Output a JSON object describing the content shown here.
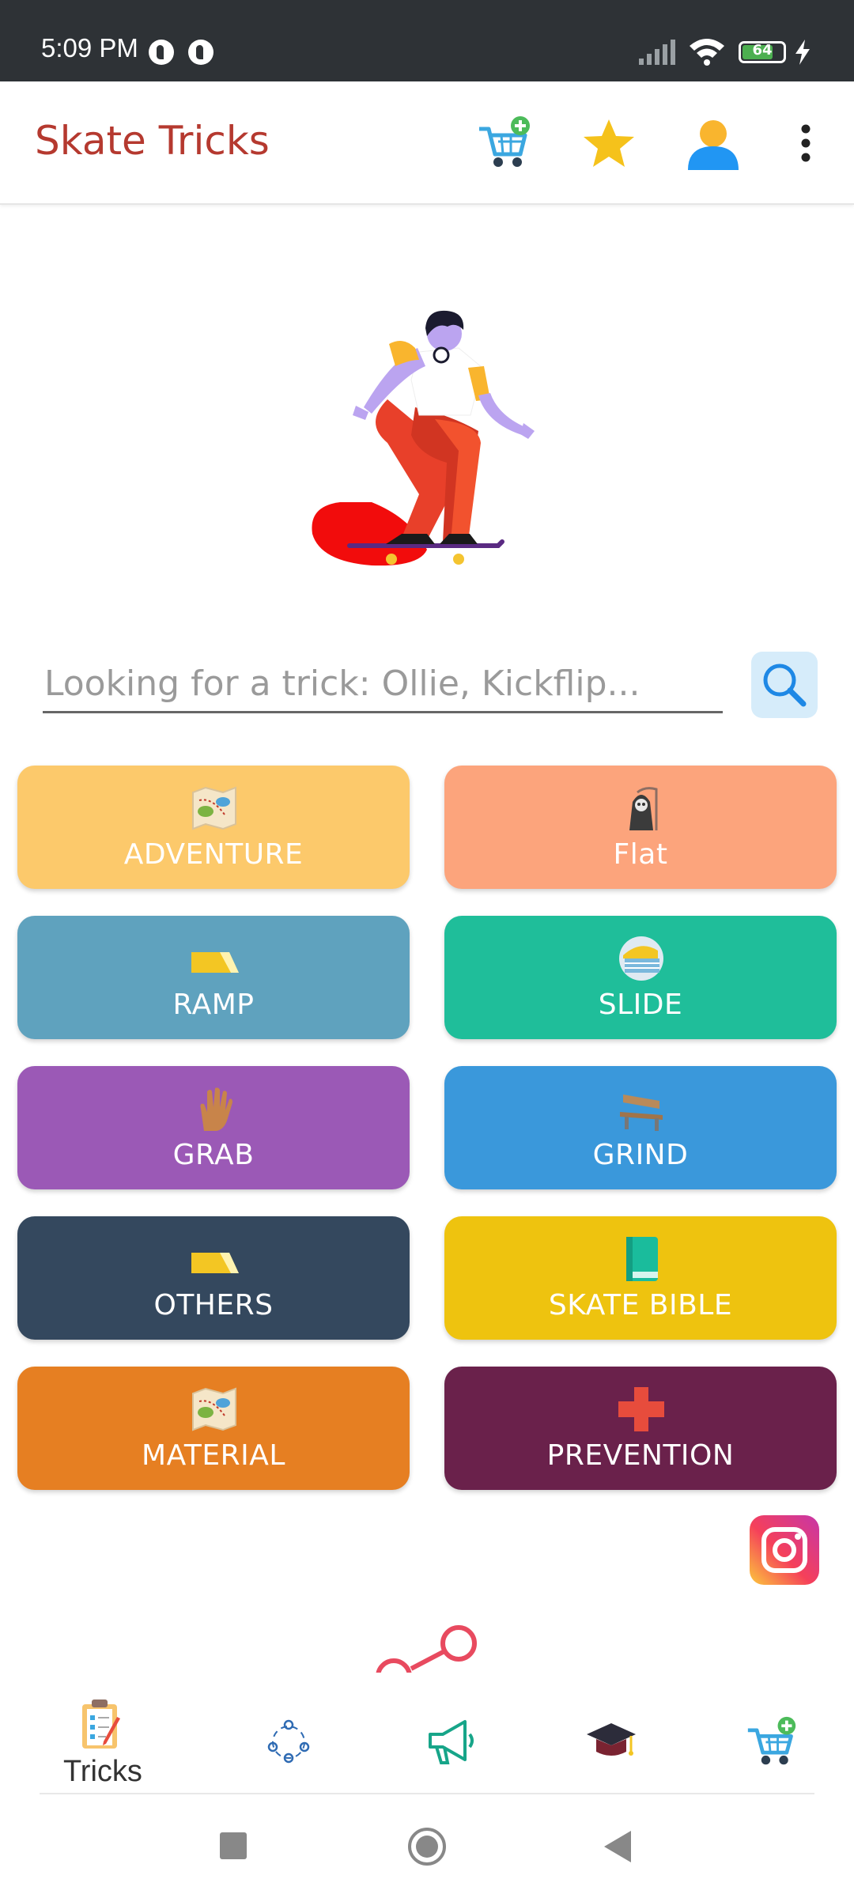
{
  "status_bar": {
    "time": "5:09 PM",
    "battery_level": "64"
  },
  "app_bar": {
    "title": "Skate Tricks",
    "icons": [
      "cart-add-icon",
      "star-icon",
      "profile-icon",
      "more-vert-icon"
    ]
  },
  "search": {
    "placeholder": "Looking for a trick: Ollie, Kickflip..."
  },
  "categories": [
    {
      "label": "ADVENTURE",
      "icon": "map-icon",
      "color": "#fcc96b"
    },
    {
      "label": "Flat",
      "icon": "grim-reaper-icon",
      "color": "#fca47c"
    },
    {
      "label": "RAMP",
      "icon": "ramp-icon",
      "color": "#5fa2be"
    },
    {
      "label": "SLIDE",
      "icon": "slide-icon",
      "color": "#1fbe9a"
    },
    {
      "label": "GRAB",
      "icon": "hand-icon",
      "color": "#9b59b6"
    },
    {
      "label": "GRIND",
      "icon": "bench-icon",
      "color": "#3a98db"
    },
    {
      "label": "OTHERS",
      "icon": "ramp-icon",
      "color": "#34485e"
    },
    {
      "label": "SKATE BIBLE",
      "icon": "book-icon",
      "color": "#eec30f"
    },
    {
      "label": "MATERIAL",
      "icon": "map-icon",
      "color": "#e67f22"
    },
    {
      "label": "PREVENTION",
      "icon": "red-cross-icon",
      "color": "#6a214b"
    }
  ],
  "bottom_nav": [
    {
      "label": "Tricks",
      "icon": "clipboard-icon"
    },
    {
      "label": "",
      "icon": "community-icon"
    },
    {
      "label": "",
      "icon": "megaphone-icon"
    },
    {
      "label": "",
      "icon": "graduation-cap-icon"
    },
    {
      "label": "",
      "icon": "cart-add-icon"
    }
  ],
  "colors": {
    "title": "#b5392f",
    "accent_blue": "#2196f3",
    "star": "#f5c21b"
  }
}
